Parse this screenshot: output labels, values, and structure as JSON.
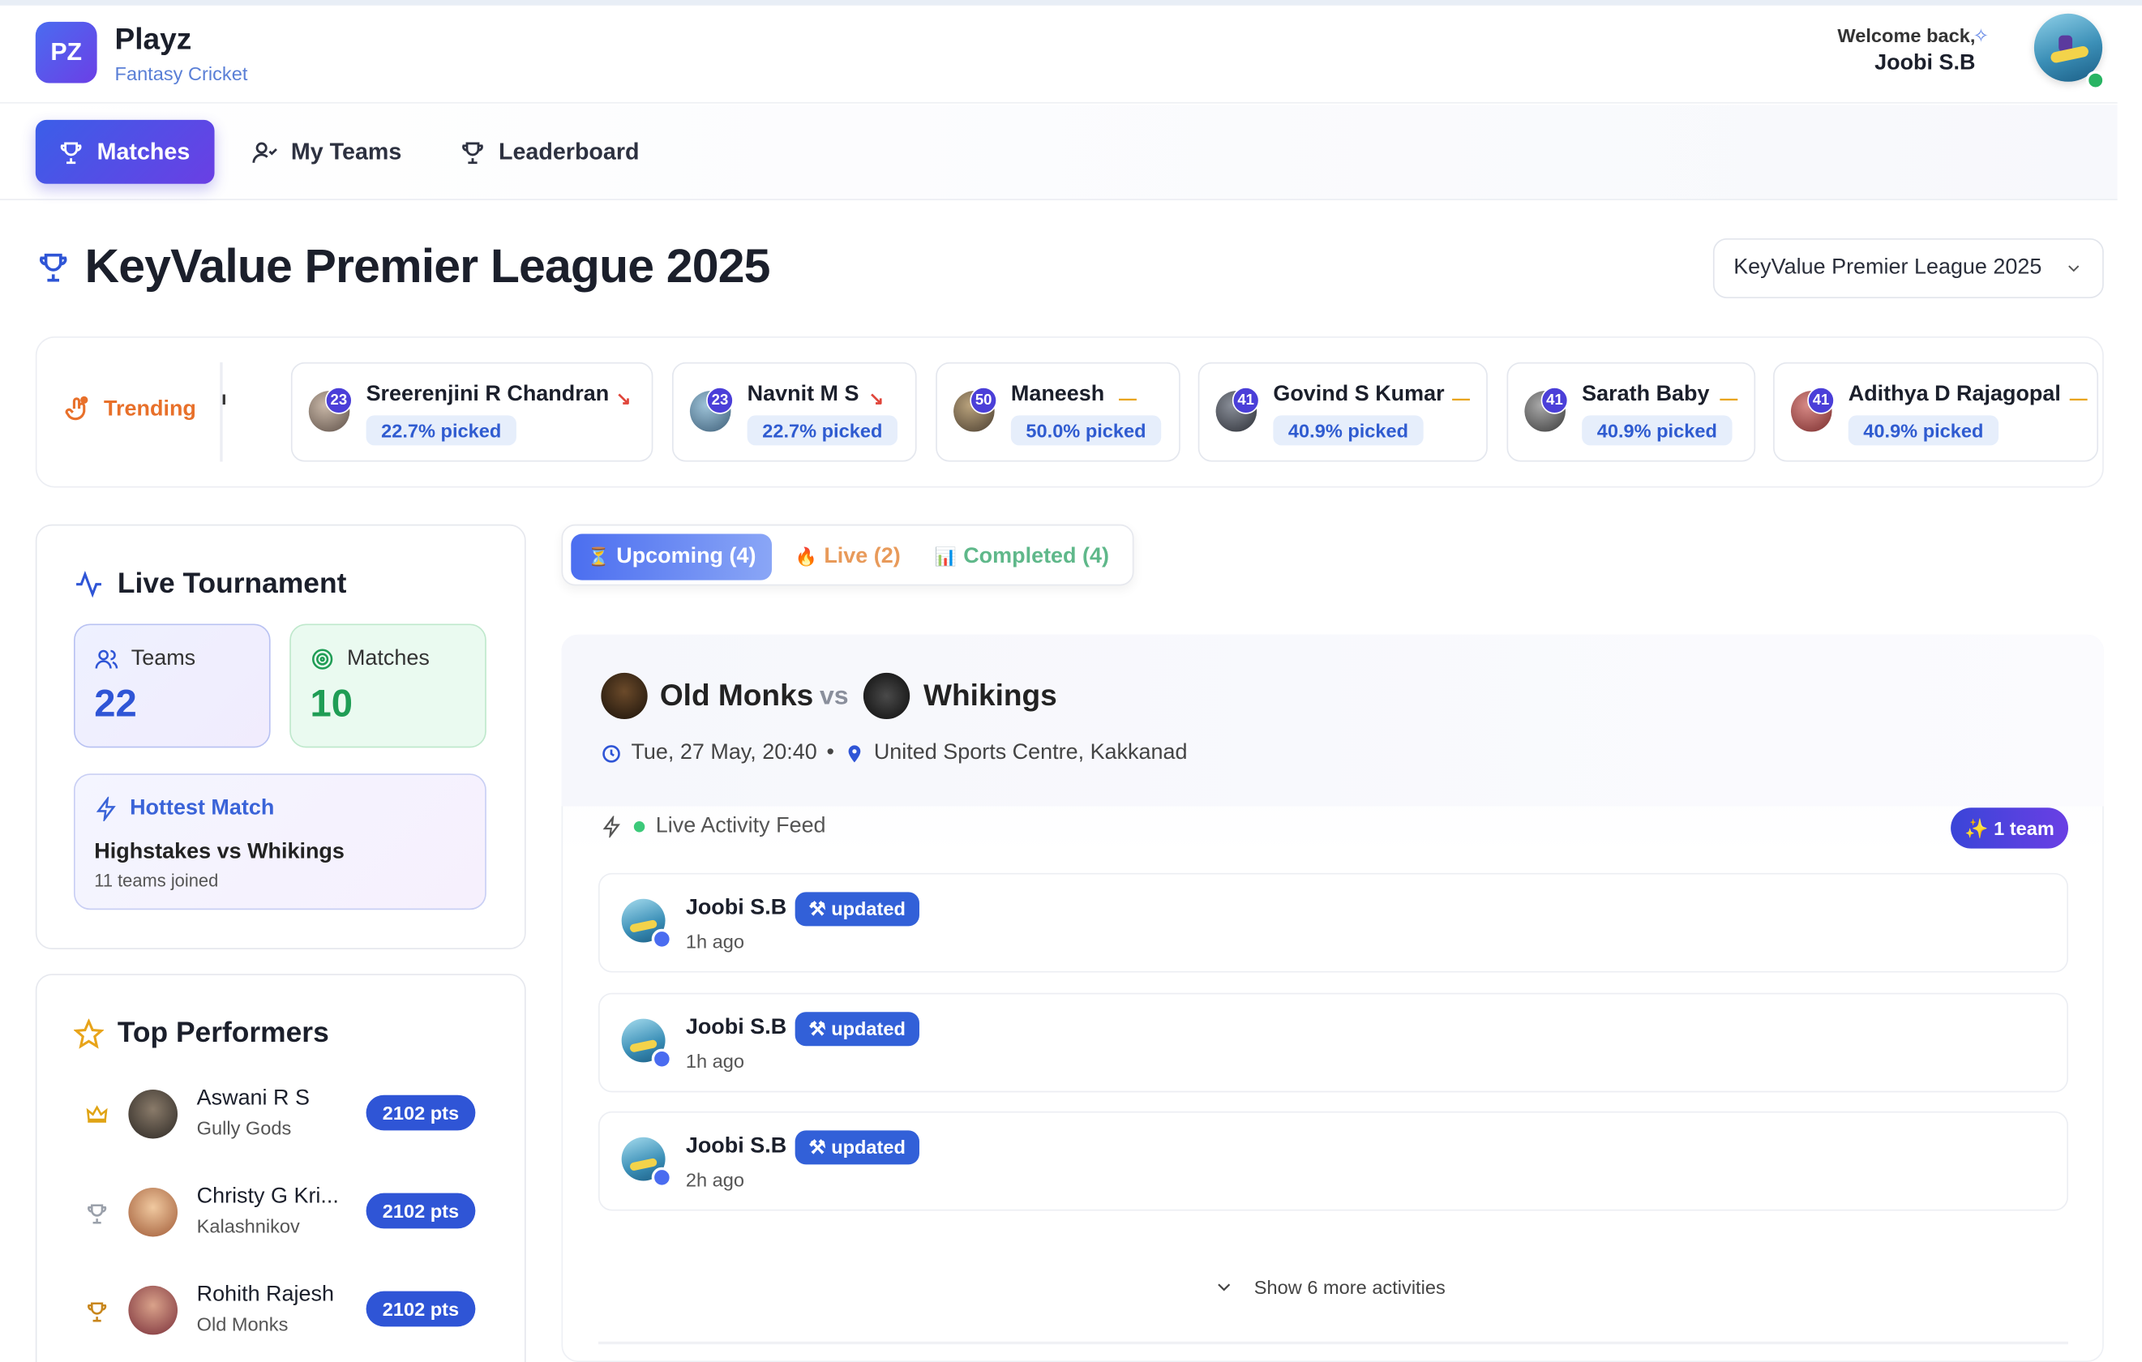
{
  "app": {
    "logo": "PZ",
    "name": "Playz",
    "subtitle": "Fantasy Cricket"
  },
  "user": {
    "welcome": "Welcome back,",
    "name": "Joobi S.B"
  },
  "nav": {
    "items": [
      {
        "label": "Matches",
        "icon": "trophy-icon"
      },
      {
        "label": "My Teams",
        "icon": "user-check-icon"
      },
      {
        "label": "Leaderboard",
        "icon": "trophy-icon"
      }
    ]
  },
  "page": {
    "title": "KeyValue Premier League 2025",
    "league_select": "KeyValue Premier League 2025"
  },
  "trending": {
    "label": "Trending",
    "players": [
      {
        "name": "Sreerenjini R Chandran",
        "points": "23",
        "picked": "22.7% picked",
        "trend": "down"
      },
      {
        "name": "Navnit M S",
        "points": "23",
        "picked": "22.7% picked",
        "trend": "down"
      },
      {
        "name": "Maneesh",
        "points": "50",
        "picked": "50.0% picked",
        "trend": "flat"
      },
      {
        "name": "Govind S Kumar",
        "points": "41",
        "picked": "40.9% picked",
        "trend": "flat"
      },
      {
        "name": "Sarath Baby",
        "points": "41",
        "picked": "40.9% picked",
        "trend": "flat"
      },
      {
        "name": "Adithya D Rajagopal",
        "points": "41",
        "picked": "40.9% picked",
        "trend": "flat"
      }
    ]
  },
  "tournament": {
    "title": "Live Tournament",
    "teams_label": "Teams",
    "teams_value": "22",
    "matches_label": "Matches",
    "matches_value": "10",
    "hottest_label": "Hottest Match",
    "hottest_match": "Highstakes vs Whikings",
    "hottest_joined": "11 teams joined"
  },
  "top_performers": {
    "title": "Top Performers",
    "items": [
      {
        "name": "Aswani R S",
        "team": "Gully Gods",
        "points": "2102 pts",
        "rank_icon": "crown-icon"
      },
      {
        "name": "Christy G Kri...",
        "team": "Kalashnikov",
        "points": "2102 pts",
        "rank_icon": "trophy-silver-icon"
      },
      {
        "name": "Rohith Rajesh",
        "team": "Old Monks",
        "points": "2102 pts",
        "rank_icon": "trophy-bronze-icon"
      }
    ]
  },
  "tabs": [
    {
      "label": "Upcoming (4)",
      "emoji": "⏳",
      "color": "#ffffff"
    },
    {
      "label": "Live (2)",
      "emoji": "🔥",
      "color": "#e89a5a"
    },
    {
      "label": "Completed (4)",
      "emoji": "📊",
      "color": "#5fb88a"
    }
  ],
  "match": {
    "team_a": "Old Monks",
    "vs": "vs",
    "team_b": "Whikings",
    "datetime": "Tue, 27 May, 20:40",
    "separator": "•",
    "venue": "United Sports Centre, Kakkanad",
    "feed_title": "Live Activity Feed",
    "team_badge": "✨ 1 team",
    "activities": [
      {
        "name": "Joobi S.B",
        "badge": "⚒ updated",
        "time": "1h ago"
      },
      {
        "name": "Joobi S.B",
        "badge": "⚒ updated",
        "time": "1h ago"
      },
      {
        "name": "Joobi S.B",
        "badge": "⚒ updated",
        "time": "2h ago"
      }
    ],
    "more": "Show 6 more activities"
  }
}
